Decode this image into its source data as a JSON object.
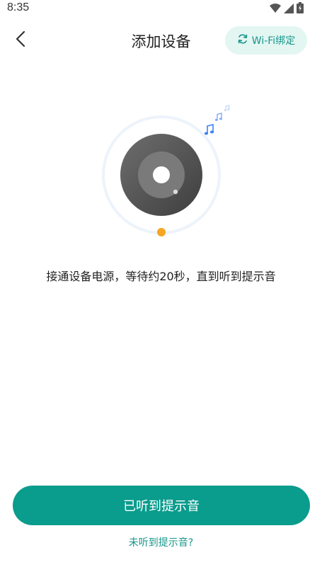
{
  "status_bar": {
    "time": "8:35"
  },
  "header": {
    "title": "添加设备",
    "wifi_bind_label": "Wi-Fi绑定"
  },
  "main": {
    "instruction": "接通设备电源，等待约20秒，直到听到提示音"
  },
  "actions": {
    "primary_label": "已听到提示音",
    "secondary_label": "未听到提示音?"
  },
  "colors": {
    "accent": "#0a9c8d",
    "accent_light": "#e3f6f2",
    "indicator": "#f5a623",
    "note_blue": "#3b82f6"
  }
}
